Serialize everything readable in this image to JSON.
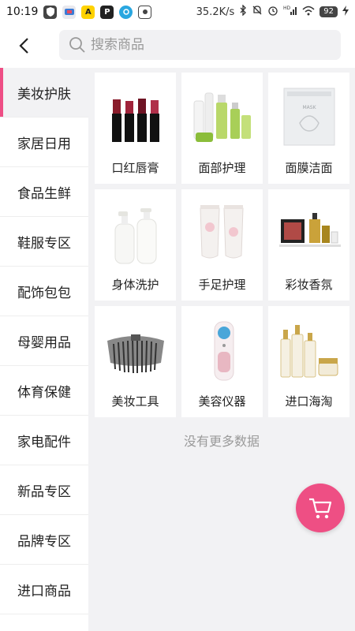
{
  "status_bar": {
    "time": "10:19",
    "speed": "35.2K/s",
    "battery": "92",
    "app_icons": [
      "shield-icon",
      "tv-app-icon",
      "yellow-app-icon",
      "p-app-icon",
      "blue-app-icon",
      "photo-app-icon"
    ]
  },
  "header": {
    "back_icon": "chevron-left-icon",
    "search_placeholder": "搜索商品"
  },
  "sidebar": {
    "items": [
      {
        "label": "美妆护肤",
        "active": true
      },
      {
        "label": "家居日用",
        "active": false
      },
      {
        "label": "食品生鲜",
        "active": false
      },
      {
        "label": "鞋服专区",
        "active": false
      },
      {
        "label": "配饰包包",
        "active": false
      },
      {
        "label": "母婴用品",
        "active": false
      },
      {
        "label": "体育保健",
        "active": false
      },
      {
        "label": "家电配件",
        "active": false
      },
      {
        "label": "新品专区",
        "active": false
      },
      {
        "label": "品牌专区",
        "active": false
      },
      {
        "label": "进口商品",
        "active": false
      }
    ]
  },
  "grid": {
    "items": [
      {
        "label": "口红唇膏",
        "icon": "lipstick-icon"
      },
      {
        "label": "面部护理",
        "icon": "skincare-bottles-icon"
      },
      {
        "label": "面膜洁面",
        "icon": "face-mask-icon"
      },
      {
        "label": "身体洗护",
        "icon": "body-wash-icon"
      },
      {
        "label": "手足护理",
        "icon": "hand-cream-icon"
      },
      {
        "label": "彩妆香氛",
        "icon": "makeup-perfume-icon"
      },
      {
        "label": "美妆工具",
        "icon": "brush-set-icon"
      },
      {
        "label": "美容仪器",
        "icon": "beauty-device-icon"
      },
      {
        "label": "进口海淘",
        "icon": "import-cosmetics-icon"
      }
    ]
  },
  "footer_text": "没有更多数据",
  "accent_color": "#ee4f84"
}
